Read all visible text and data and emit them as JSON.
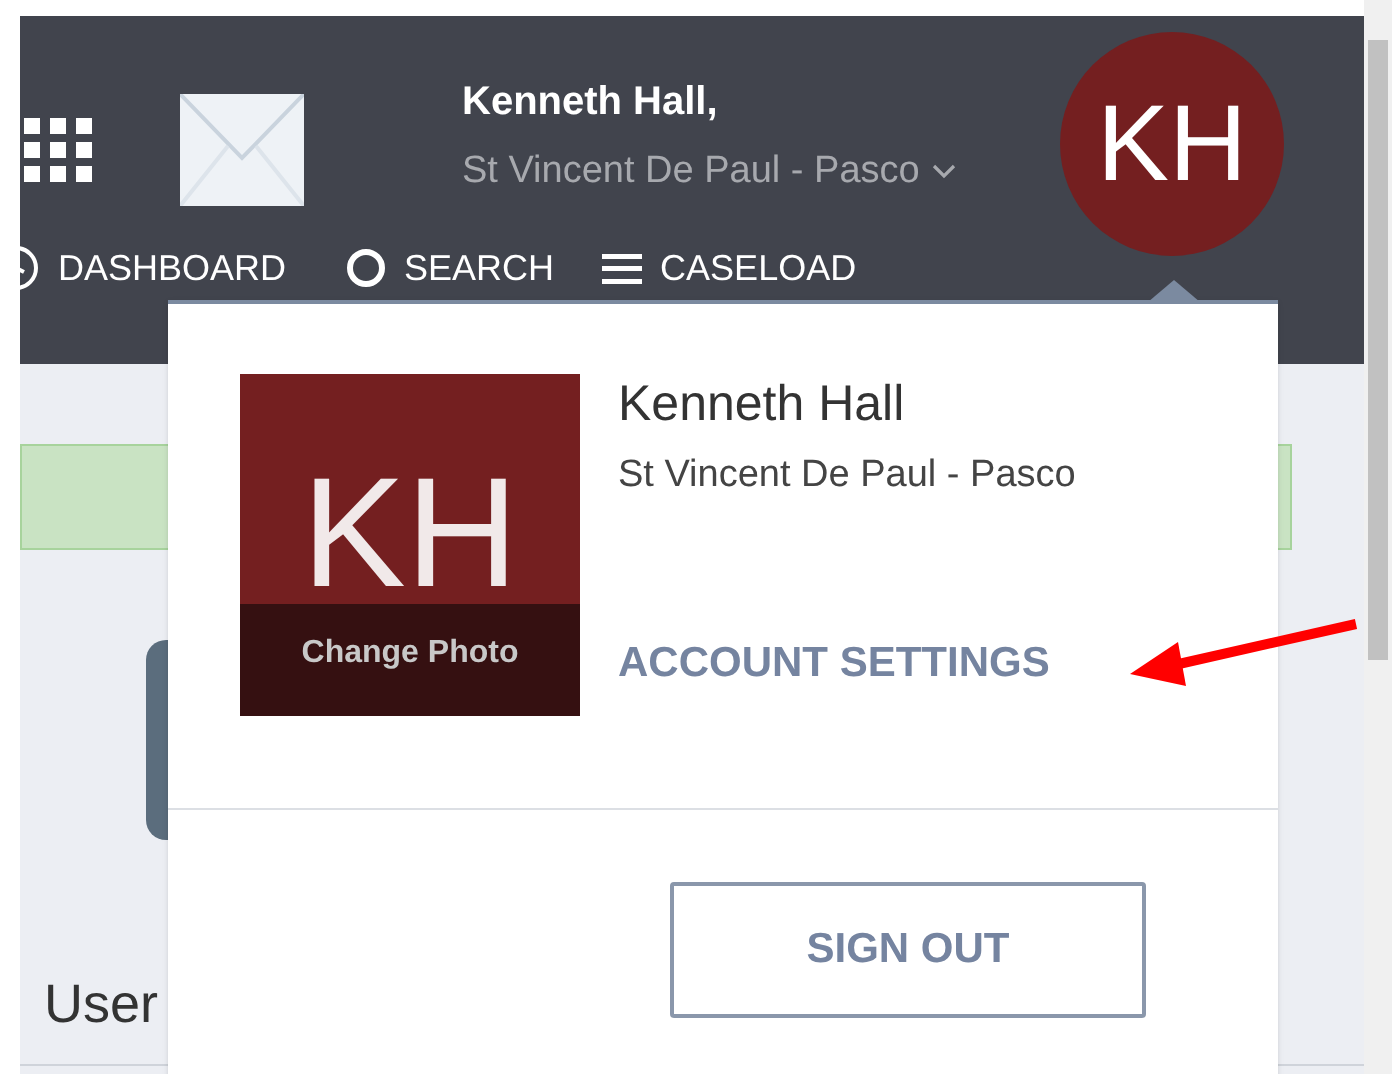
{
  "header": {
    "user_name": "Kenneth Hall,",
    "organization": "St Vincent De Paul - Pasco",
    "avatar_initials": "KH"
  },
  "nav": [
    {
      "label": "DASHBOARD",
      "kind": "clock"
    },
    {
      "label": "SEARCH",
      "kind": "search"
    },
    {
      "label": "CASELOAD",
      "kind": "list"
    }
  ],
  "page": {
    "heading": "User"
  },
  "profile_menu": {
    "photo_initials": "KH",
    "photo_action": "Change Photo",
    "name": "Kenneth Hall",
    "organization": "St Vincent De Paul - Pasco",
    "account_settings": "ACCOUNT SETTINGS",
    "sign_out": "SIGN OUT"
  }
}
